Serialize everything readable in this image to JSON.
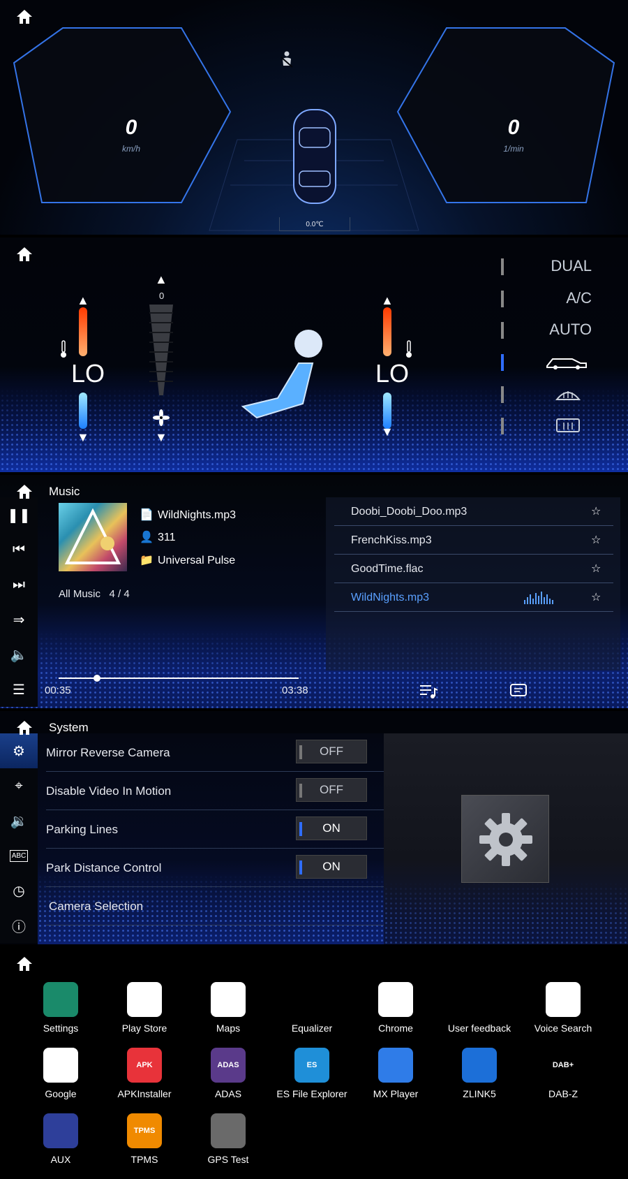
{
  "dashboard": {
    "speed_value": "0",
    "speed_unit": "km/h",
    "rpm_value": "0",
    "rpm_unit": "1/min",
    "outside_temp": "0.0℃"
  },
  "climate": {
    "left_temp": "LO",
    "right_temp": "LO",
    "fan_level": "0",
    "buttons": [
      {
        "label": "DUAL",
        "active": false
      },
      {
        "label": "A/C",
        "active": false
      },
      {
        "label": "AUTO",
        "active": false
      },
      {
        "label": "",
        "icon": "car-recirculation-icon",
        "active": true
      },
      {
        "label": "",
        "icon": "front-defrost-icon",
        "active": false
      },
      {
        "label": "",
        "icon": "rear-defrost-icon",
        "active": false
      }
    ]
  },
  "music": {
    "title": "Music",
    "file_name": "WildNights.mp3",
    "artist": "311",
    "album": "Universal Pulse",
    "playlist_name": "All Music",
    "track_position": "4 / 4",
    "elapsed": "00:35",
    "duration": "03:38",
    "progress_fraction": 0.16,
    "tracks": [
      {
        "name": "Doobi_Doobi_Doo.mp3",
        "playing": false
      },
      {
        "name": "FrenchKiss.mp3",
        "playing": false
      },
      {
        "name": "GoodTime.flac",
        "playing": false
      },
      {
        "name": "WildNights.mp3",
        "playing": true
      }
    ]
  },
  "system": {
    "title": "System",
    "rows": [
      {
        "label": "Mirror Reverse Camera",
        "value": "OFF"
      },
      {
        "label": "Disable Video In Motion",
        "value": "OFF"
      },
      {
        "label": "Parking Lines",
        "value": "ON"
      },
      {
        "label": "Park Distance Control",
        "value": "ON"
      },
      {
        "label": "Camera Selection",
        "value": ""
      }
    ]
  },
  "apps": [
    {
      "label": "Settings",
      "color": "#1a8a6a"
    },
    {
      "label": "Play Store",
      "color": "#ffffff"
    },
    {
      "label": "Maps",
      "color": "#ffffff"
    },
    {
      "label": "Equalizer",
      "color": "#000000"
    },
    {
      "label": "Chrome",
      "color": "#ffffff"
    },
    {
      "label": "User feedback",
      "color": "#000000"
    },
    {
      "label": "Voice Search",
      "color": "#ffffff"
    },
    {
      "label": "Google",
      "color": "#ffffff"
    },
    {
      "label": "APKInstaller",
      "color": "#e8333a",
      "badge": "APK"
    },
    {
      "label": "ADAS",
      "color": "#5a3a8a",
      "badge": "ADAS"
    },
    {
      "label": "ES File Explorer",
      "color": "#1f8fd8",
      "badge": "ES"
    },
    {
      "label": "MX Player",
      "color": "#2f7ce8"
    },
    {
      "label": "ZLINK5",
      "color": "#1c6fd8"
    },
    {
      "label": "DAB-Z",
      "color": "#000000",
      "badge": "DAB+"
    },
    {
      "label": "AUX",
      "color": "#2e3f9a"
    },
    {
      "label": "TPMS",
      "color": "#f08a00",
      "badge": "TPMS"
    },
    {
      "label": "GPS Test",
      "color": "#6a6a6a"
    }
  ]
}
